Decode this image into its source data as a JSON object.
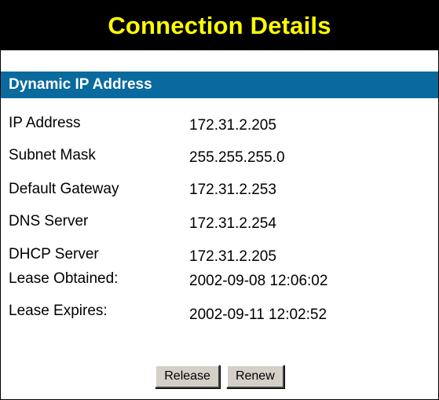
{
  "title": "Connection Details",
  "section_title": "Dynamic IP Address",
  "details": [
    {
      "label": "IP Address",
      "value": "172.31.2.205"
    },
    {
      "label": "Subnet Mask",
      "value": "255.255.255.0"
    },
    {
      "label": "Default Gateway",
      "value": "172.31.2.253"
    },
    {
      "label": "DNS Server",
      "value": "172.31.2.254"
    },
    {
      "label": "DHCP Server",
      "value": "172.31.2.205"
    },
    {
      "label": "Lease Obtained:",
      "value": "2002-09-08 12:06:02"
    },
    {
      "label": "Lease Expires:",
      "value": "2002-09-11 12:02:52"
    }
  ],
  "buttons": {
    "release_label": "Release",
    "renew_label": "Renew"
  },
  "colors": {
    "title_background": "#000000",
    "title_text": "#ffff00",
    "section_background": "#0a6a9e",
    "section_text": "#ffffff",
    "button_face": "#d4d0c8"
  }
}
